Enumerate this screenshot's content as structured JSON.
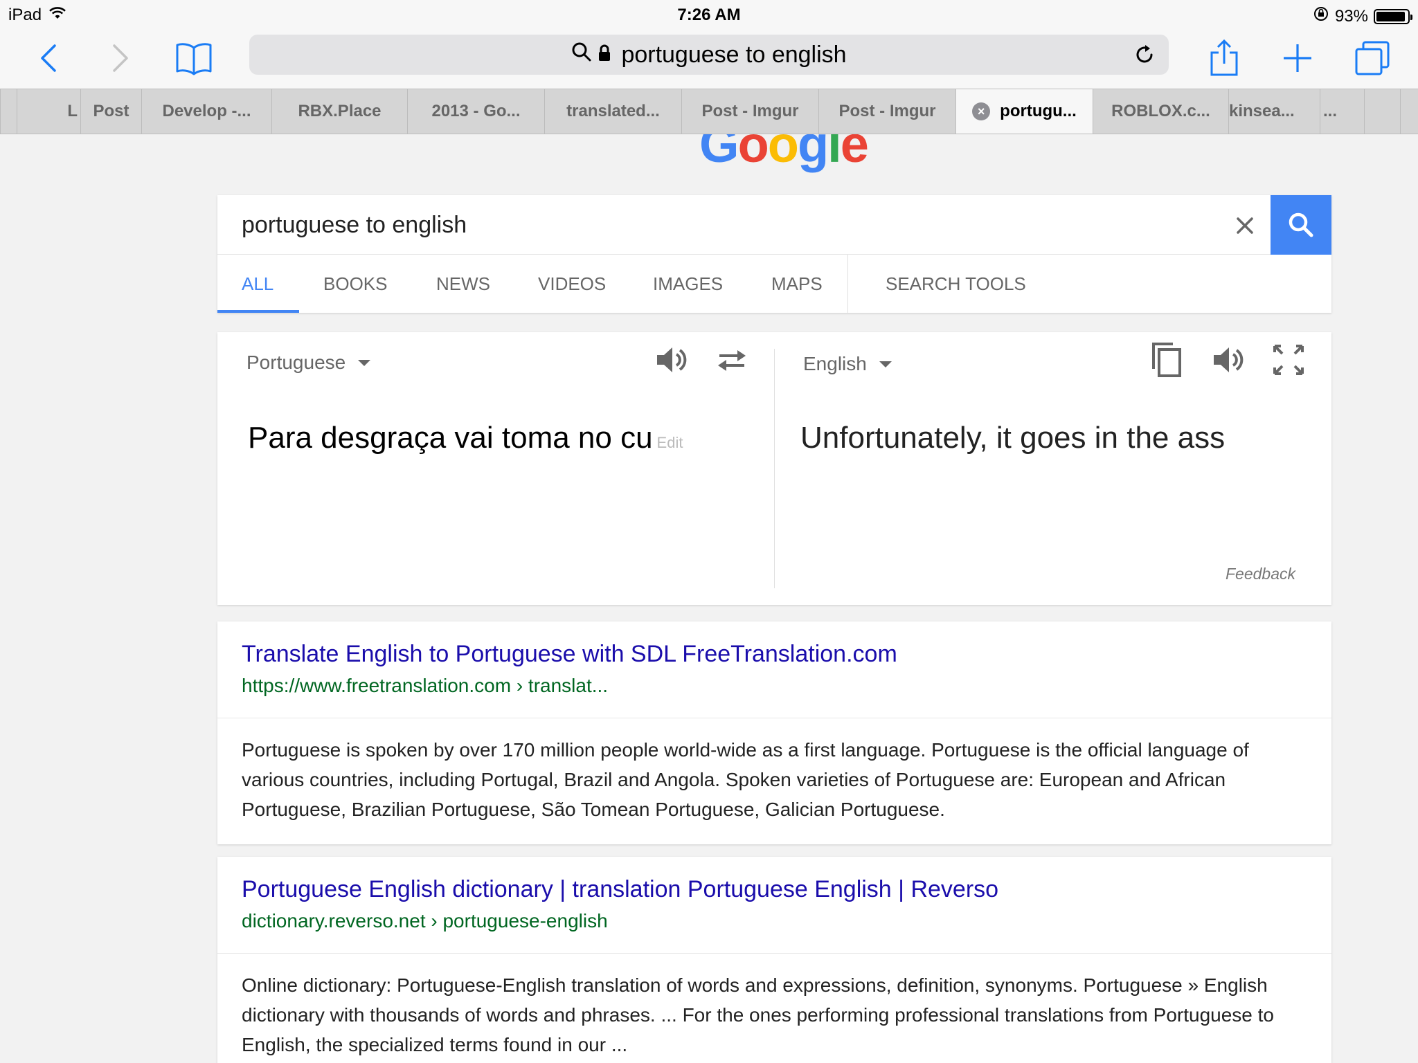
{
  "status_bar": {
    "device": "iPad",
    "time": "7:26 AM",
    "battery_percent": "93%",
    "battery_level": 0.93
  },
  "toolbar": {
    "address_text": "portuguese to english"
  },
  "tabs": [
    {
      "label": "L"
    },
    {
      "label": "Post"
    },
    {
      "label": "Develop -..."
    },
    {
      "label": "RBX.Place"
    },
    {
      "label": "2013 - Go..."
    },
    {
      "label": "translated..."
    },
    {
      "label": "Post - Imgur"
    },
    {
      "label": "Post - Imgur"
    },
    {
      "label": "portugu...",
      "active": true
    },
    {
      "label": "ROBLOX.c..."
    },
    {
      "label": "kinsea..."
    },
    {
      "label": "..."
    }
  ],
  "google": {
    "logo": [
      "G",
      "o",
      "o",
      "g",
      "l",
      "e"
    ],
    "logo_colors": [
      "#4285f4",
      "#ea4335",
      "#fbbc05",
      "#4285f4",
      "#34a853",
      "#ea4335"
    ],
    "search_query": "portuguese to english",
    "search_tabs": [
      "ALL",
      "BOOKS",
      "NEWS",
      "VIDEOS",
      "IMAGES",
      "MAPS",
      "SEARCH TOOLS"
    ],
    "accent_color": "#4285f4"
  },
  "translate": {
    "source_language": "Portuguese",
    "target_language": "English",
    "source_text": "Para desgraça vai toma no cu",
    "edit_label": "Edit",
    "target_text": "Unfortunately, it goes in the ass",
    "feedback_label": "Feedback"
  },
  "results": [
    {
      "title": "Translate English to Portuguese with SDL FreeTranslation.com",
      "url": "https://www.freetranslation.com › translat...",
      "snippet": "Portuguese is spoken by over 170 million people world-wide as a first language. Portuguese is the official language of various countries, including Portugal, Brazil and Angola. Spoken varieties of Portuguese are: European and African Portuguese, Brazilian Portuguese, São Tomean Portuguese, Galician Portuguese."
    },
    {
      "title": "Portuguese English dictionary | translation Portuguese English | Reverso",
      "url": "dictionary.reverso.net › portuguese-english",
      "snippet": "Online dictionary: Portuguese-English translation of words and expressions, definition, synonyms. Portuguese » English dictionary with thousands of words and phrases. ... For the ones performing professional translations from Portuguese to English, the specialized terms found in our ..."
    }
  ]
}
